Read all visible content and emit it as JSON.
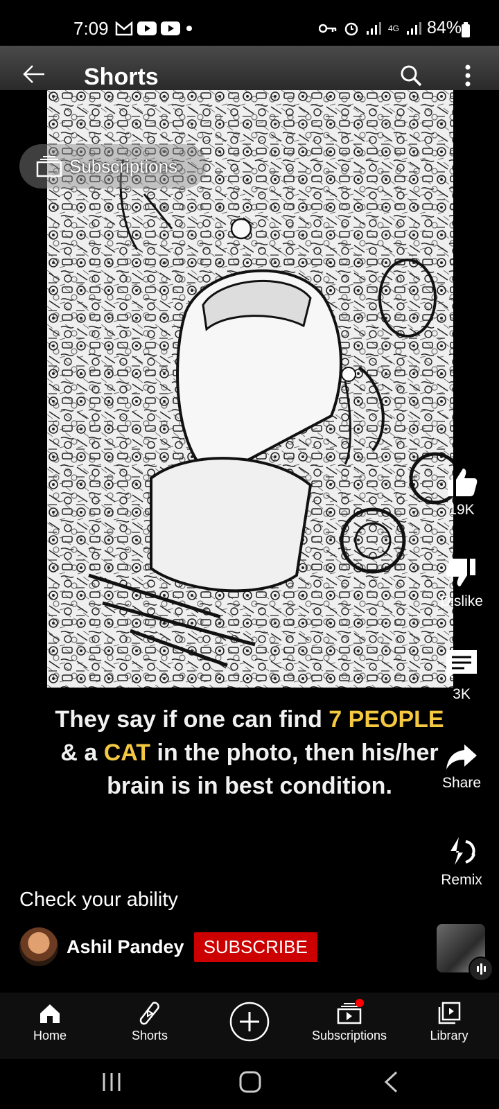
{
  "status_bar": {
    "time": "7:09",
    "battery": "84%",
    "signal_label": "4G"
  },
  "top_bar": {
    "title": "Shorts"
  },
  "subscriptions_pill": {
    "label": "Subscriptions"
  },
  "overlay": {
    "part1": "They say if one can find ",
    "highlight1": "7 PEOPLE",
    "part2": "& a ",
    "highlight2": "CAT",
    "part3": " in the photo, then his/her",
    "part4": "brain is in best condition."
  },
  "actions": {
    "like_count": "19K",
    "dislike_label": "Dislike",
    "comment_count": "3K",
    "share_label": "Share",
    "remix_label": "Remix"
  },
  "caption": "Check your ability",
  "channel": {
    "name": "Ashil Pandey",
    "subscribe_label": "SUBSCRIBE"
  },
  "bottom_nav": [
    {
      "label": "Home"
    },
    {
      "label": "Shorts"
    },
    {
      "label": ""
    },
    {
      "label": "Subscriptions"
    },
    {
      "label": "Library"
    }
  ],
  "colors": {
    "subscribe_red": "#cc0000",
    "highlight_yellow": "#f5c842",
    "notification_dot": "#ff0000"
  }
}
